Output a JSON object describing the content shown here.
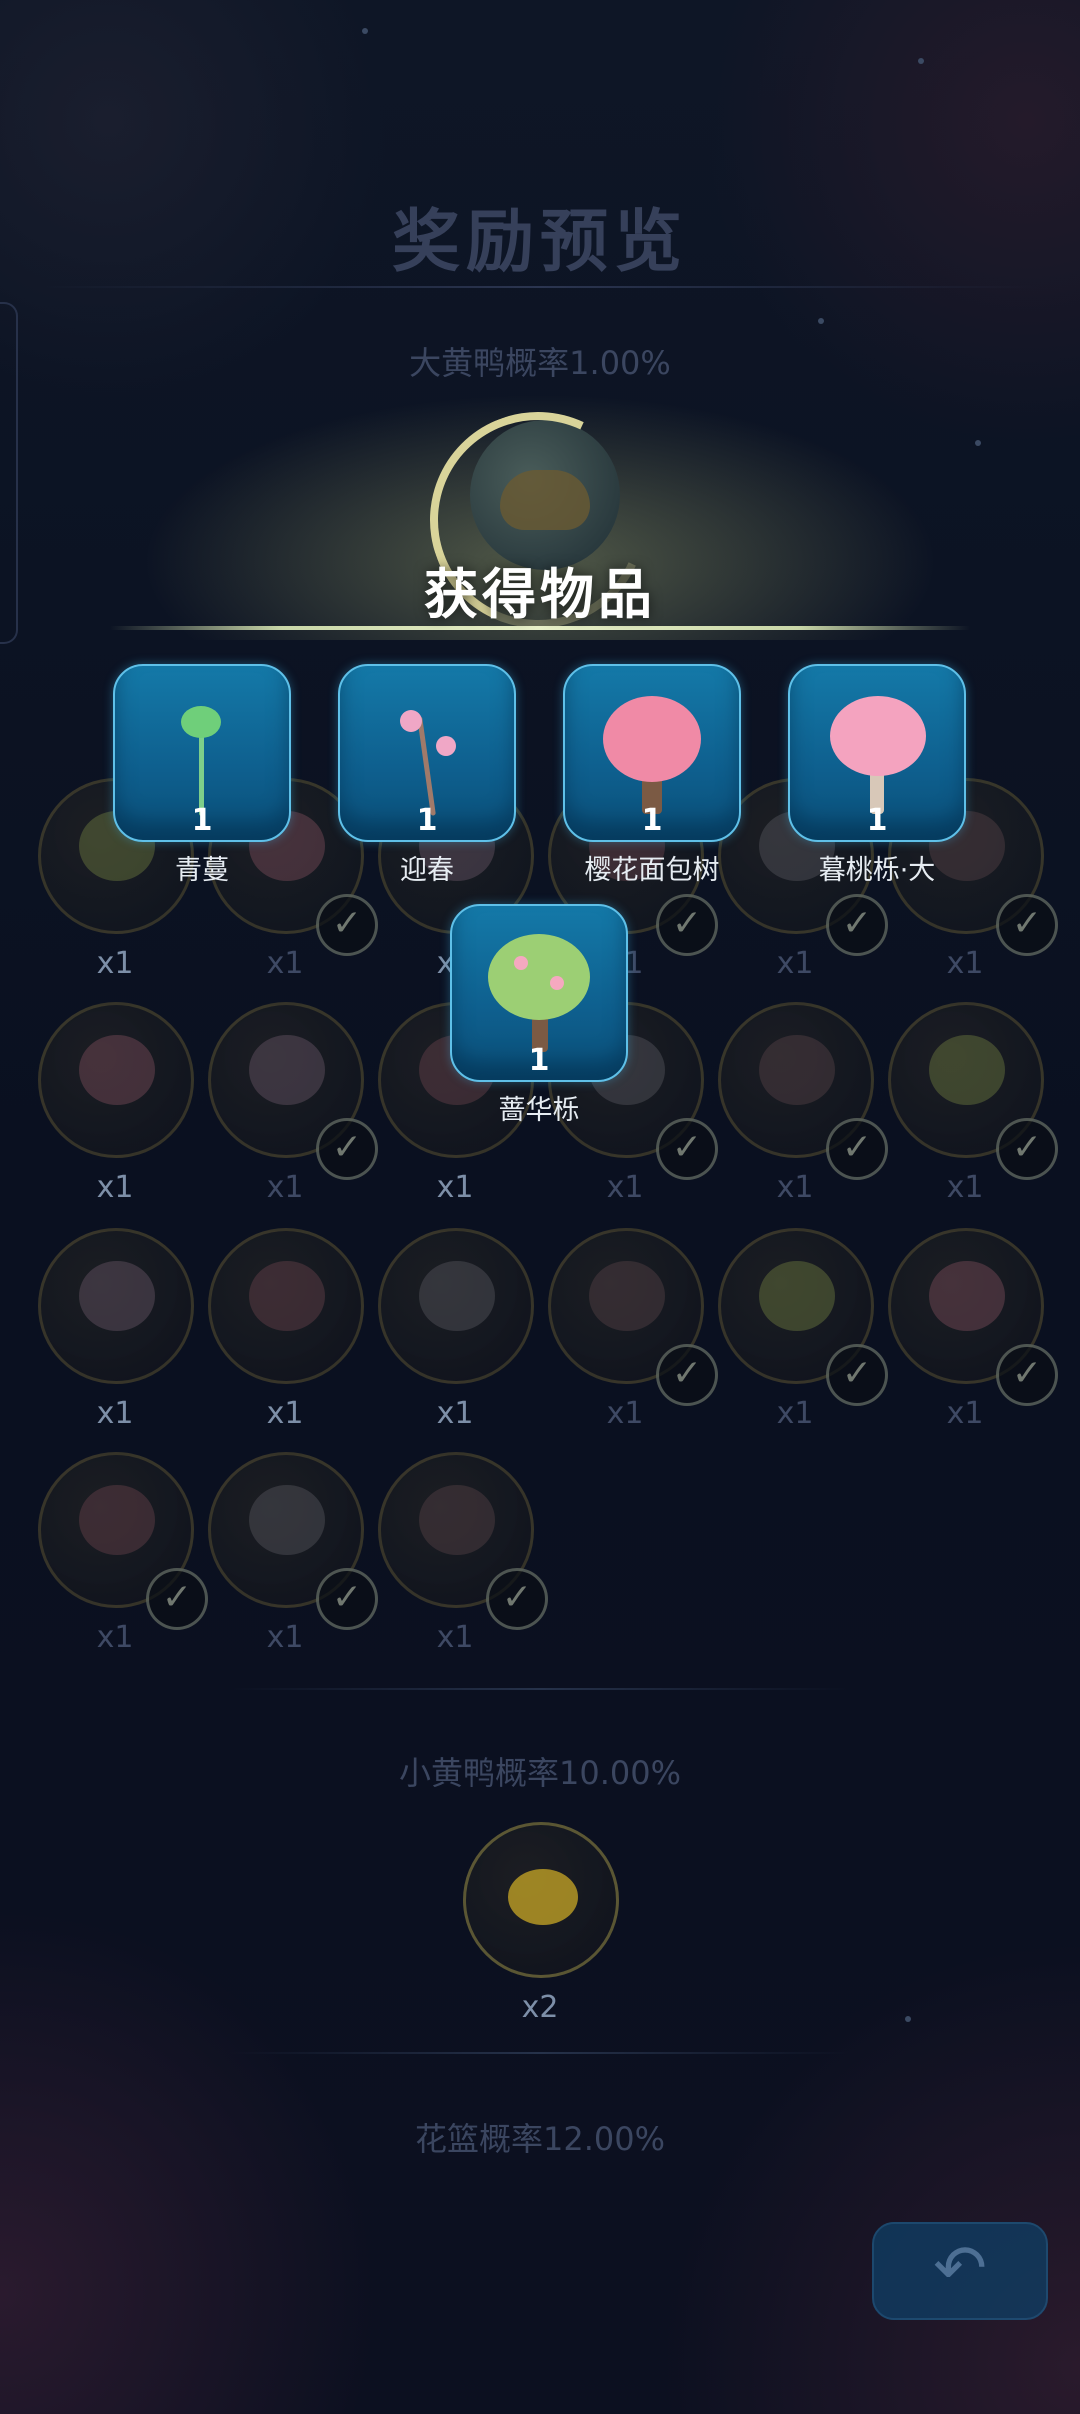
{
  "header": {
    "title": "奖励预览"
  },
  "sections": {
    "big_duck_rate": "大黄鸭概率1.00%",
    "small_duck_rate": "小黄鸭概率10.00%",
    "flower_rate": "花篮概率12.00%"
  },
  "grid": {
    "rows": [
      [
        {
          "qty": "x1",
          "checked": false
        },
        {
          "qty": "x1",
          "checked": true
        },
        {
          "qty": "x1",
          "checked": false
        },
        {
          "qty": "x1",
          "checked": true
        },
        {
          "qty": "x1",
          "checked": true
        },
        {
          "qty": "x1",
          "checked": true
        }
      ],
      [
        {
          "qty": "x1",
          "checked": false
        },
        {
          "qty": "x1",
          "checked": true
        },
        {
          "qty": "x1",
          "checked": false
        },
        {
          "qty": "x1",
          "checked": true
        },
        {
          "qty": "x1",
          "checked": true
        },
        {
          "qty": "x1",
          "checked": true
        }
      ],
      [
        {
          "qty": "x1",
          "checked": false
        },
        {
          "qty": "x1",
          "checked": false
        },
        {
          "qty": "x1",
          "checked": false
        },
        {
          "qty": "x1",
          "checked": true
        },
        {
          "qty": "x1",
          "checked": true
        },
        {
          "qty": "x1",
          "checked": true
        }
      ],
      [
        {
          "qty": "x1",
          "checked": true
        },
        {
          "qty": "x1",
          "checked": true
        },
        {
          "qty": "x1",
          "checked": true
        }
      ]
    ]
  },
  "small_duck": {
    "qty": "x2"
  },
  "popup": {
    "title": "获得物品",
    "items": [
      {
        "name": "青蔓",
        "count": "1"
      },
      {
        "name": "迎春",
        "count": "1"
      },
      {
        "name": "樱花面包树",
        "count": "1"
      },
      {
        "name": "暮桃栎·大",
        "count": "1"
      },
      {
        "name": "蔷华栎",
        "count": "1"
      }
    ]
  },
  "controls": {
    "back_icon": "undo-arrow-icon"
  },
  "colors": {
    "card_bg": "#1479a8",
    "card_border": "#5fc0e8",
    "title_dim": "#36405a"
  }
}
